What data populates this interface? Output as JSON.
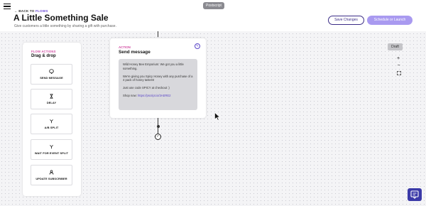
{
  "header": {
    "brand": "Postscript",
    "back_arrow": "←",
    "back_prefix": "BACK TO ",
    "back_flows": "FLOWS",
    "title": "A Little Something Sale",
    "subtitle": "Give customers a little something by sharing a gift with purchase.",
    "save_label": "Save Changes",
    "launch_label": "Schedule or Launch"
  },
  "panel": {
    "eyebrow": "FLOW ACTIONS",
    "title": "Drag & drop",
    "tiles": [
      {
        "label": "SEND MESSAGE",
        "icon": "chat-icon",
        "glyph": "💬"
      },
      {
        "label": "DELAY",
        "icon": "hourglass-icon",
        "glyph": "⧗"
      },
      {
        "label": "A/B SPLIT",
        "icon": "split-icon",
        "glyph": "⑂"
      },
      {
        "label": "WAIT FOR EVENT SPLIT",
        "icon": "event-split-icon",
        "glyph": "⑂"
      },
      {
        "label": "UPDATE SUBSCRIBER",
        "icon": "user-edit-icon",
        "glyph": "👤"
      }
    ]
  },
  "card": {
    "eyebrow": "ACTION",
    "title": "Send message",
    "edit_glyph": "✎",
    "message": {
      "line1": "Wild Honey Bee Emporium: We got you a little something.",
      "line2": "We're giving you Spicy Honey with any purchase of a 4 pack of honey tasters!",
      "line3": "Just use code SPICY at checkout :)",
      "shop_label": "Shop now: ",
      "shop_link": "https://pscript.io/3AERE2"
    }
  },
  "canvas": {
    "draft_label": "Draft",
    "zoom_in_glyph": "+",
    "zoom_out_glyph": "−",
    "fit_glyph": "⛶",
    "end_glyph": "✓"
  },
  "colors": {
    "accent": "#6c4bd6",
    "eyebrow": "#d14ba1",
    "launch_button": "#a99af0",
    "help_button": "#3b3aa8"
  }
}
